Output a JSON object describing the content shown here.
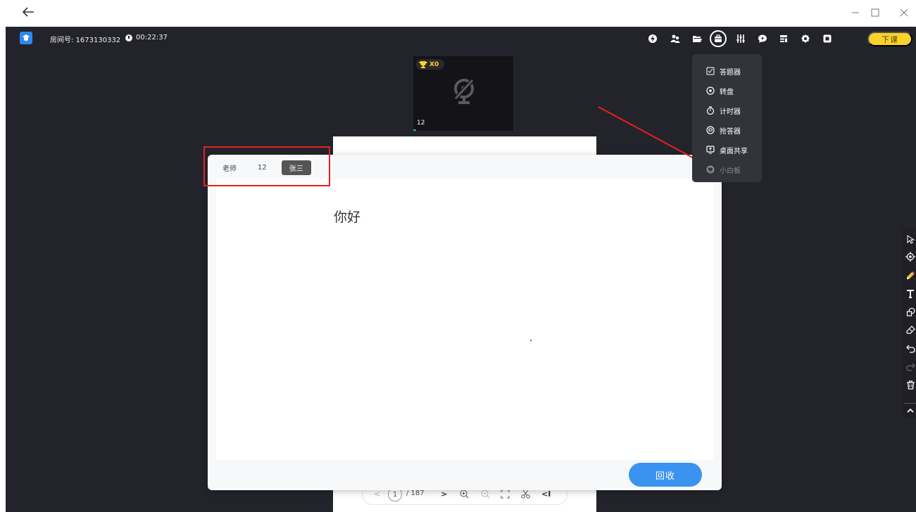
{
  "titlebar": {
    "back_icon": "arrow-left-icon",
    "window_controls": [
      "minimize-icon",
      "maximize-icon",
      "close-icon"
    ]
  },
  "classroom": {
    "room_label": "房间号: 1673130332",
    "elapsed_time": "00:22:37",
    "end_class_label": "下课",
    "top_tools": [
      "lightning-icon",
      "users-icon",
      "folder-icon",
      "toolbox-icon",
      "sliders-icon",
      "chat-icon",
      "layout-icon",
      "settings-icon",
      "square-icon"
    ],
    "accent_color": "#fbd22c"
  },
  "video_tile": {
    "trophy_count": "X0",
    "name": "12",
    "camera_state_icon": "camera-off-icon"
  },
  "tools_menu": {
    "items": [
      {
        "label": "答题器",
        "icon": "answer-icon",
        "enabled": true
      },
      {
        "label": "转盘",
        "icon": "wheel-icon",
        "enabled": true
      },
      {
        "label": "计时器",
        "icon": "stopwatch-icon",
        "enabled": true
      },
      {
        "label": "抢答器",
        "icon": "buzzer-icon",
        "enabled": true
      },
      {
        "label": "桌面共享",
        "icon": "screen-share-icon",
        "enabled": true
      },
      {
        "label": "小白板",
        "icon": "whiteboard-icon",
        "enabled": false
      }
    ]
  },
  "whiteboard": {
    "tabs": [
      {
        "label": "老师",
        "active": false
      },
      {
        "label": "12",
        "active": false
      },
      {
        "label": "张三",
        "active": true
      }
    ],
    "canvas_text": "你好",
    "recycle_label": "回收",
    "recycle_color": "#3b93f0"
  },
  "pager": {
    "current_page": "1",
    "total_pages": "/ 187"
  },
  "draw_tools": [
    "cursor-icon",
    "laser-pointer-icon",
    "pencil-icon",
    "text-tool-icon",
    "shape-icon",
    "eraser-icon",
    "undo-icon",
    "redo-icon",
    "trash-icon",
    "collapse-up-icon"
  ],
  "annotation_color": "#e8201d"
}
